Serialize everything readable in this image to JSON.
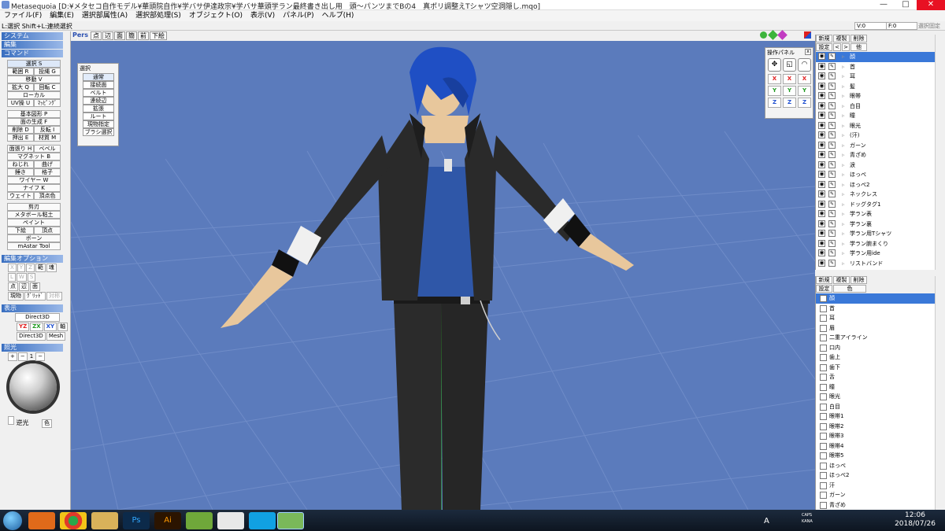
{
  "window": {
    "title": "Metasequoia [D:¥メタセコ自作モデル¥華頭院自作¥学バサ伊達政宗¥学バサ華頭学ラン最終書き出し用　頭〜パンツまでBの4　真ポリ調整えTシャツ空洞隠し.mqo]",
    "minimize": "—",
    "maximize": "□",
    "close": "✕"
  },
  "menu": [
    "ファイル(F)",
    "編集(E)",
    "選択部属性(A)",
    "選択部処理(S)",
    "オブジェクト(O)",
    "表示(V)",
    "パネル(P)",
    "ヘルプ(H)"
  ],
  "status": {
    "hint": "L:選択  Shift+L:連続選択",
    "v_label": "V:0",
    "f_label": "F:0",
    "action": "選択固定"
  },
  "left": {
    "sections": {
      "system": "システム",
      "edit": "編集",
      "command": "コマンド",
      "edit_option": "編集オプション",
      "display": "表示",
      "lighting": "照光"
    },
    "cmd_select": "選択 S",
    "cmd_pairs_1": [
      [
        "範囲 R",
        "投縄 G"
      ]
    ],
    "cmd_move": "移動 V",
    "cmd_pairs_2": [
      [
        "拡大 Q",
        "回転 C"
      ]
    ],
    "cmd_local": "ローカル",
    "cmd_pairs_3": [
      [
        "UV操 U",
        "ﾏｯﾋﾟﾝｸﾞ"
      ]
    ],
    "cmd_basic": "基本図形 P",
    "cmd_face": "面の生成 F",
    "cmd_pairs_4": [
      [
        "削除 D",
        "反転 I"
      ],
      [
        "押出 E",
        "材質 M"
      ]
    ],
    "cmd_pairs_5": [
      [
        "面張り H",
        "ベベル"
      ]
    ],
    "cmd_magnet": "マグネット B",
    "cmd_pairs_6": [
      [
        "ねじれ",
        "曲げ"
      ],
      [
        "錘き",
        "格子"
      ]
    ],
    "cmd_wire": "ワイヤー W",
    "cmd_knife": "ナイフ K",
    "cmd_pairs_7": [
      [
        "ウェイト",
        "頂点色"
      ]
    ],
    "cmd_cut": "剪刃",
    "cmd_metaball": "メタボール粘土",
    "cmd_paint": "ペイント",
    "cmd_pairs_8": [
      [
        "下絵",
        "頂点"
      ]
    ],
    "cmd_bone": "ボーン",
    "cmd_mastar": "mAstar Tool",
    "opt_axes": [
      "X",
      "Y",
      "Z",
      "範",
      "魂"
    ],
    "opt_row2": [
      "L",
      "W",
      "S"
    ],
    "opt_row3": [
      "点",
      "辺",
      "面"
    ],
    "opt_row4": [
      "現物",
      "ｸﾞﾘｯﾄﾞ",
      "対称"
    ],
    "disp_direct3d": "Direct3D",
    "disp_views": [
      "YZ",
      "ZX",
      "XY",
      "軸"
    ],
    "disp_direct3d2": "Direct3D",
    "disp_mesh": "Mesh",
    "light_btns": [
      "+",
      "−",
      "1",
      "−"
    ],
    "light_reverse": "逆光",
    "light_color": "色"
  },
  "viewport": {
    "mode": "Pers",
    "tools": [
      "点",
      "辺",
      "面",
      "簡",
      "前",
      "下絵"
    ],
    "character_desc": "blue-haired male figure in T-pose on grid"
  },
  "select_panel": {
    "title": "選択",
    "items": [
      "通常",
      "接続面",
      "ベルト",
      "連続辺",
      "拡張",
      "ルート",
      "現物指定",
      "ブラシ選択"
    ]
  },
  "op_panel": {
    "title": "操作パネル",
    "icons": [
      "✥",
      "◱",
      "◠"
    ],
    "rows": [
      [
        "X",
        "X",
        "X"
      ],
      [
        "Y",
        "Y",
        "Y"
      ],
      [
        "Z",
        "Z",
        "Z"
      ]
    ],
    "colors": {
      "x": "#e02020",
      "y": "#1f9a1f",
      "z": "#2050d0"
    }
  },
  "objects": {
    "toolbar": [
      "新規",
      "複製",
      "削除",
      "設定",
      "<",
      ">",
      "他"
    ],
    "items": [
      "顔",
      "首",
      "耳",
      "髪",
      "眼帯",
      "白目",
      "瞳",
      "眼光",
      "(汗)",
      "ガーン",
      "青ざめ",
      "涙",
      "ほっぺ",
      "ほっぺ2",
      "ネックレス",
      "ドッグタグ1",
      "学ラン表",
      "学ラン裏",
      "学ラン用Tシャツ",
      "学ラン腕まくり",
      "学ラン用ide",
      "リストバンド"
    ]
  },
  "materials": {
    "toolbar": [
      "新規",
      "複製",
      "削除",
      "設定",
      "色"
    ],
    "items": [
      "顔",
      "首",
      "耳",
      "眉",
      "二重アイライン",
      "口内",
      "歯上",
      "歯下",
      "舌",
      "瞳",
      "眼光",
      "白目",
      "眼帯1",
      "眼帯2",
      "眼帯3",
      "眼帯4",
      "眼帯5",
      "ほっぺ",
      "ほっぺ2",
      "汗",
      "ガーン",
      "青ざめ"
    ]
  },
  "taskbar": {
    "lang": "A",
    "clock_time": "12:06",
    "clock_date": "2018/07/26",
    "caps": "CAPS",
    "kana": "KANA"
  }
}
